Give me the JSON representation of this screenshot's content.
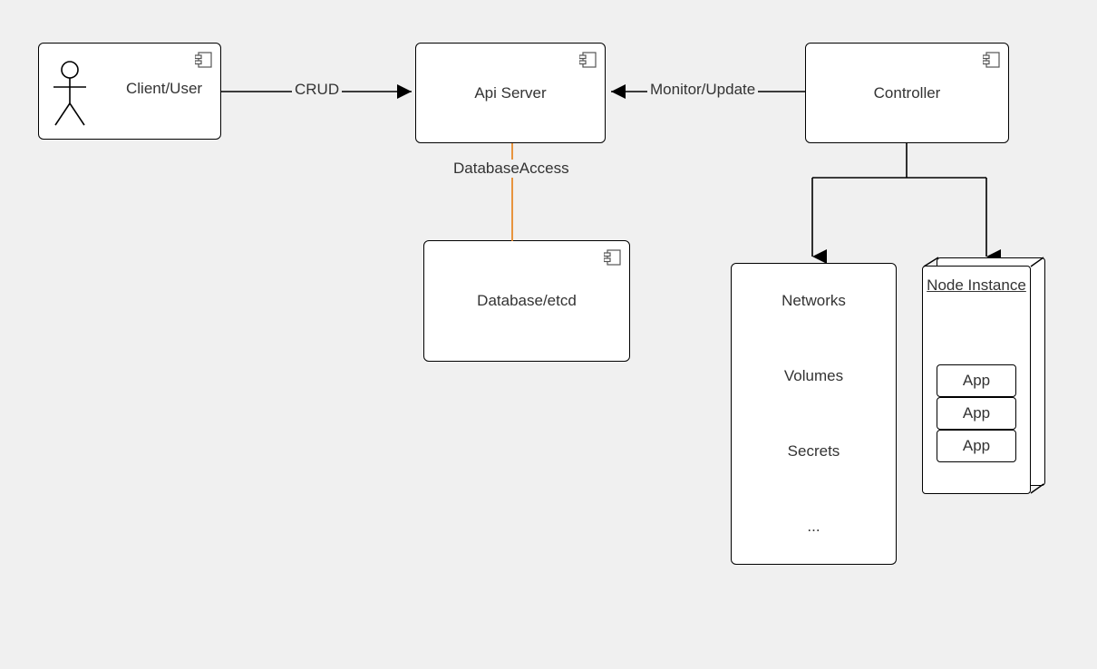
{
  "components": {
    "client": "Client/User",
    "api": "Api Server",
    "controller": "Controller",
    "db": "Database/etcd"
  },
  "edges": {
    "crud": "CRUD",
    "monitor": "Monitor/Update",
    "dbaccess": "DatabaseAccess"
  },
  "resources": {
    "networks": "Networks",
    "volumes": "Volumes",
    "secrets": "Secrets",
    "more": "..."
  },
  "node": {
    "title": "Node Instance",
    "apps": [
      "App",
      "App",
      "App"
    ]
  },
  "colors": {
    "orange": "#e88a2a"
  }
}
